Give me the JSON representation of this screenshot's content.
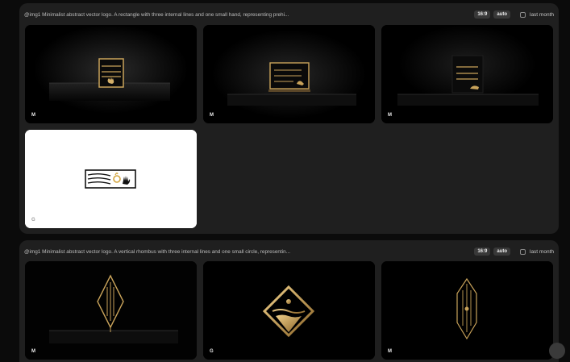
{
  "generations": [
    {
      "prompt": "@img1 Minimalist abstract vector logo. A rectangle with three internal lines and one small hand, representing prehi...",
      "aspect_ratio": "16:9",
      "mode": "auto",
      "filter_label": "last month",
      "images": [
        {
          "model_icon": "M"
        },
        {
          "model_icon": "M"
        },
        {
          "model_icon": "M"
        },
        {
          "model_icon": "G"
        }
      ]
    },
    {
      "prompt": "@img1 Minimalist abstract vector logo. A vertical rhombus with three internal lines and one small circle, representin...",
      "aspect_ratio": "16:9",
      "mode": "auto",
      "filter_label": "last month",
      "images": [
        {
          "model_icon": "M"
        },
        {
          "model_icon": "G"
        },
        {
          "model_icon": "M"
        }
      ]
    }
  ],
  "colors": {
    "gold": "#c9a35a",
    "panel": "#1f1f1f",
    "page": "#0b0b0b"
  }
}
